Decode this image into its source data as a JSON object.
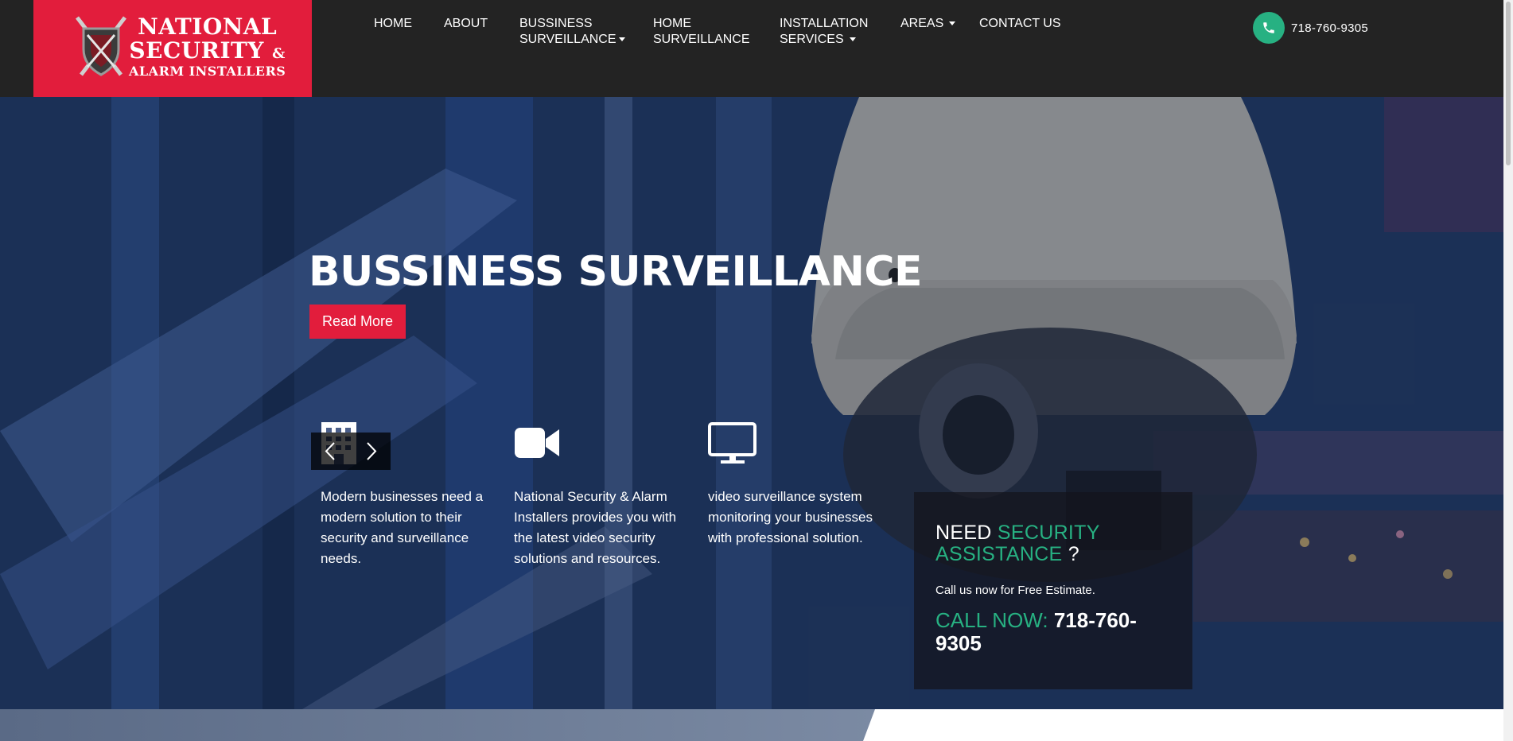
{
  "brand": {
    "line1": "NATIONAL",
    "line2": "SECURITY",
    "line2_amp": "&",
    "line3": "ALARM INSTALLERS",
    "bg_color": "#e21d3c"
  },
  "nav": {
    "items": [
      {
        "line1": "HOME",
        "line2": "",
        "has_dropdown": false
      },
      {
        "line1": "ABOUT",
        "line2": "",
        "has_dropdown": false
      },
      {
        "line1": "BUSSINESS",
        "line2": "SURVEILLANCE",
        "has_dropdown": true
      },
      {
        "line1": "HOME",
        "line2": "SURVEILLANCE",
        "has_dropdown": false
      },
      {
        "line1": "INSTALLATION",
        "line2": "SERVICES",
        "has_dropdown": true
      },
      {
        "line1": "AREAS",
        "line2": "",
        "has_dropdown": true
      },
      {
        "line1": "CONTACT US",
        "line2": "",
        "has_dropdown": false
      }
    ]
  },
  "header_phone": {
    "icon": "phone-icon",
    "number": "718-760-9305",
    "accent": "#27b182"
  },
  "hero": {
    "title": "BUSSINESS SURVEILLANCE",
    "button": "Read More",
    "slider_prev_icon": "chevron-left-icon",
    "slider_next_icon": "chevron-right-icon"
  },
  "features": [
    {
      "icon": "building-icon",
      "text": "Modern businesses need a modern solution to their security and surveillance needs."
    },
    {
      "icon": "video-camera-icon",
      "text": "National Security & Alarm Installers provides you with the latest video security solutions and resources."
    },
    {
      "icon": "monitor-icon",
      "text": "video surveillance system monitoring your businesses with professional solution."
    }
  ],
  "cta": {
    "need": "NEED",
    "security": "SECURITY",
    "assistance": "ASSISTANCE",
    "question": "?",
    "subtitle": "Call us now for Free Estimate.",
    "call_label": "CALL NOW:",
    "call_number": "718-760-9305",
    "accent": "#27b182"
  }
}
